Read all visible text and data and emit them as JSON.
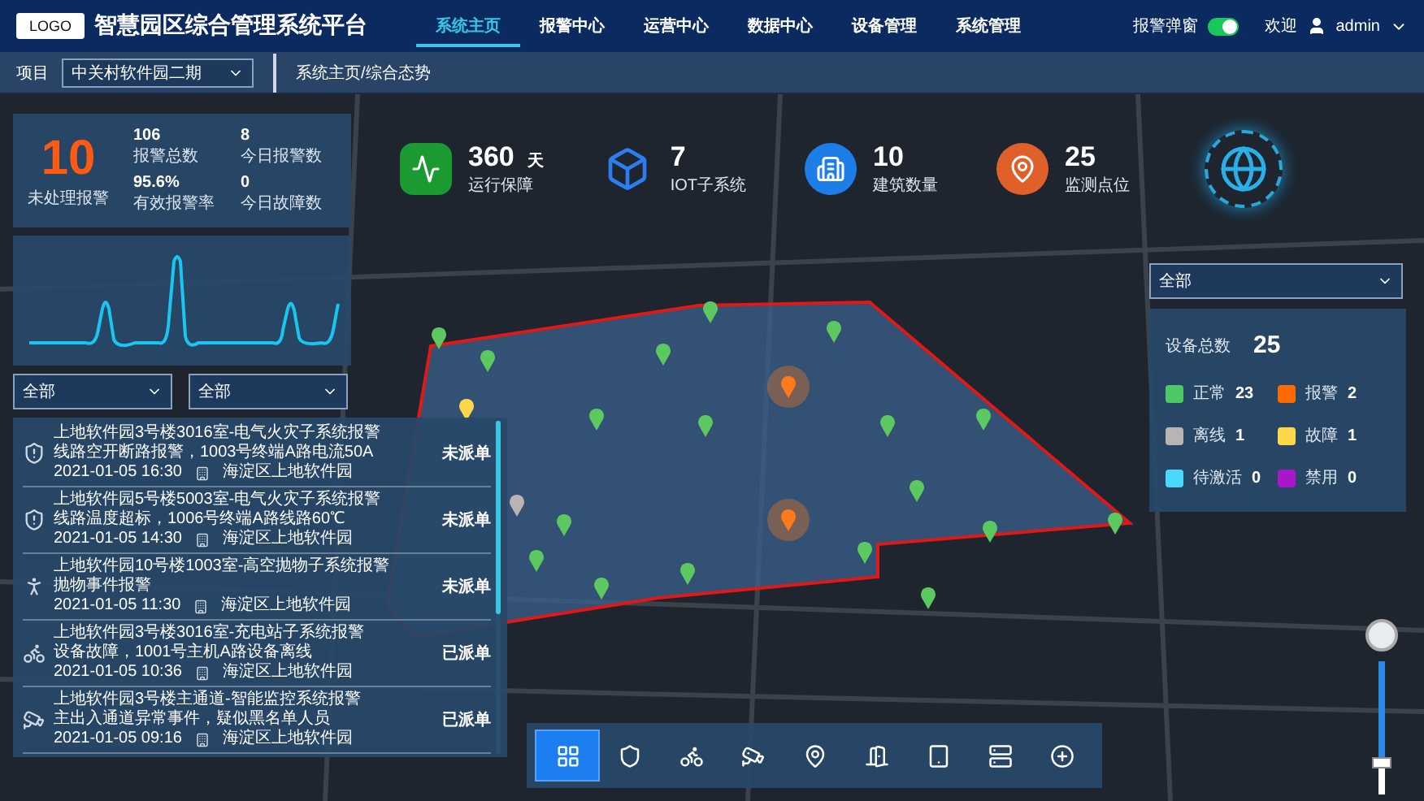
{
  "header": {
    "logo": "LOGO",
    "title": "智慧园区综合管理系统平台",
    "nav": [
      {
        "label": "系统主页",
        "selected": true
      },
      {
        "label": "报警中心",
        "selected": false
      },
      {
        "label": "运营中心",
        "selected": false
      },
      {
        "label": "数据中心",
        "selected": false
      },
      {
        "label": "设备管理",
        "selected": false
      },
      {
        "label": "系统管理",
        "selected": false
      }
    ],
    "alarm_popup": {
      "label": "报警弹窗",
      "on": true
    },
    "welcome": "欢迎",
    "user": "admin"
  },
  "subbar": {
    "project_label": "项目",
    "project_value": "中关村软件园二期",
    "breadcrumb": "系统主页/综合态势"
  },
  "summary": {
    "main": {
      "value": "10",
      "label": "未处理报警"
    },
    "stats": [
      {
        "value": "106",
        "label": "报警总数"
      },
      {
        "value": "8",
        "label": "今日报警数"
      },
      {
        "value": "95.6%",
        "label": "有效报警率"
      },
      {
        "value": "0",
        "label": "今日故障数"
      }
    ]
  },
  "kpis": [
    {
      "kind": "monitor",
      "value": "360",
      "unit": "天",
      "label": "运行保障"
    },
    {
      "kind": "cube",
      "value": "7",
      "label": "IOT子系统"
    },
    {
      "kind": "building",
      "value": "10",
      "label": "建筑数量"
    },
    {
      "kind": "pin",
      "value": "25",
      "label": "监测点位"
    }
  ],
  "left_filters": [
    "全部",
    "全部"
  ],
  "alarms": [
    {
      "kind": "fire",
      "title": "上地软件园3号楼3016室-电气火灾子系统报警",
      "detail": "线路空开断路报警，1003号终端A路电流50A",
      "time": "2021-01-05 16:30",
      "location": "海淀区上地软件园",
      "status": "未派单"
    },
    {
      "kind": "fire",
      "title": "上地软件园5号楼5003室-电气火灾子系统报警",
      "detail": "线路温度超标，1006号终端A路线路60℃",
      "time": "2021-01-05 14:30",
      "location": "海淀区上地软件园",
      "status": "未派单"
    },
    {
      "kind": "throw",
      "title": "上地软件园10号楼1003室-高空抛物子系统报警",
      "detail": "抛物事件报警",
      "time": "2021-01-05 11:30",
      "location": "海淀区上地软件园",
      "status": "未派单"
    },
    {
      "kind": "charge",
      "title": "上地软件园3号楼3016室-充电站子系统报警",
      "detail": "设备故障，1001号主机A路设备离线",
      "time": "2021-01-05 10:36",
      "location": "海淀区上地软件园",
      "status": "已派单"
    },
    {
      "kind": "camera",
      "title": "上地软件园3号楼主通道-智能监控系统报警",
      "detail": "主出入通道异常事件，疑似黑名单人员",
      "time": "2021-01-05 09:16",
      "location": "海淀区上地软件园",
      "status": "已派单"
    }
  ],
  "device_filter": "全部",
  "devices": {
    "total_label": "设备总数",
    "total": "25",
    "statuses": [
      {
        "label": "正常",
        "count": "23",
        "color": "#4cc864"
      },
      {
        "label": "报警",
        "count": "2",
        "color": "#ff6a00"
      },
      {
        "label": "离线",
        "count": "1",
        "color": "#b8b4b4"
      },
      {
        "label": "故障",
        "count": "1",
        "color": "#ffd84a"
      },
      {
        "label": "待激活",
        "count": "0",
        "color": "#4ad8ff"
      },
      {
        "label": "禁用",
        "count": "0",
        "color": "#a818c8"
      }
    ]
  },
  "toolbar": [
    {
      "kind": "grid",
      "selected": true
    },
    {
      "kind": "shield",
      "selected": false
    },
    {
      "kind": "bike",
      "selected": false
    },
    {
      "kind": "camera",
      "selected": false
    },
    {
      "kind": "pin",
      "selected": false
    },
    {
      "kind": "door",
      "selected": false
    },
    {
      "kind": "tablet",
      "selected": false
    },
    {
      "kind": "panel",
      "selected": false
    },
    {
      "kind": "plus",
      "selected": false
    }
  ],
  "zoom": {
    "level": 0.75
  }
}
